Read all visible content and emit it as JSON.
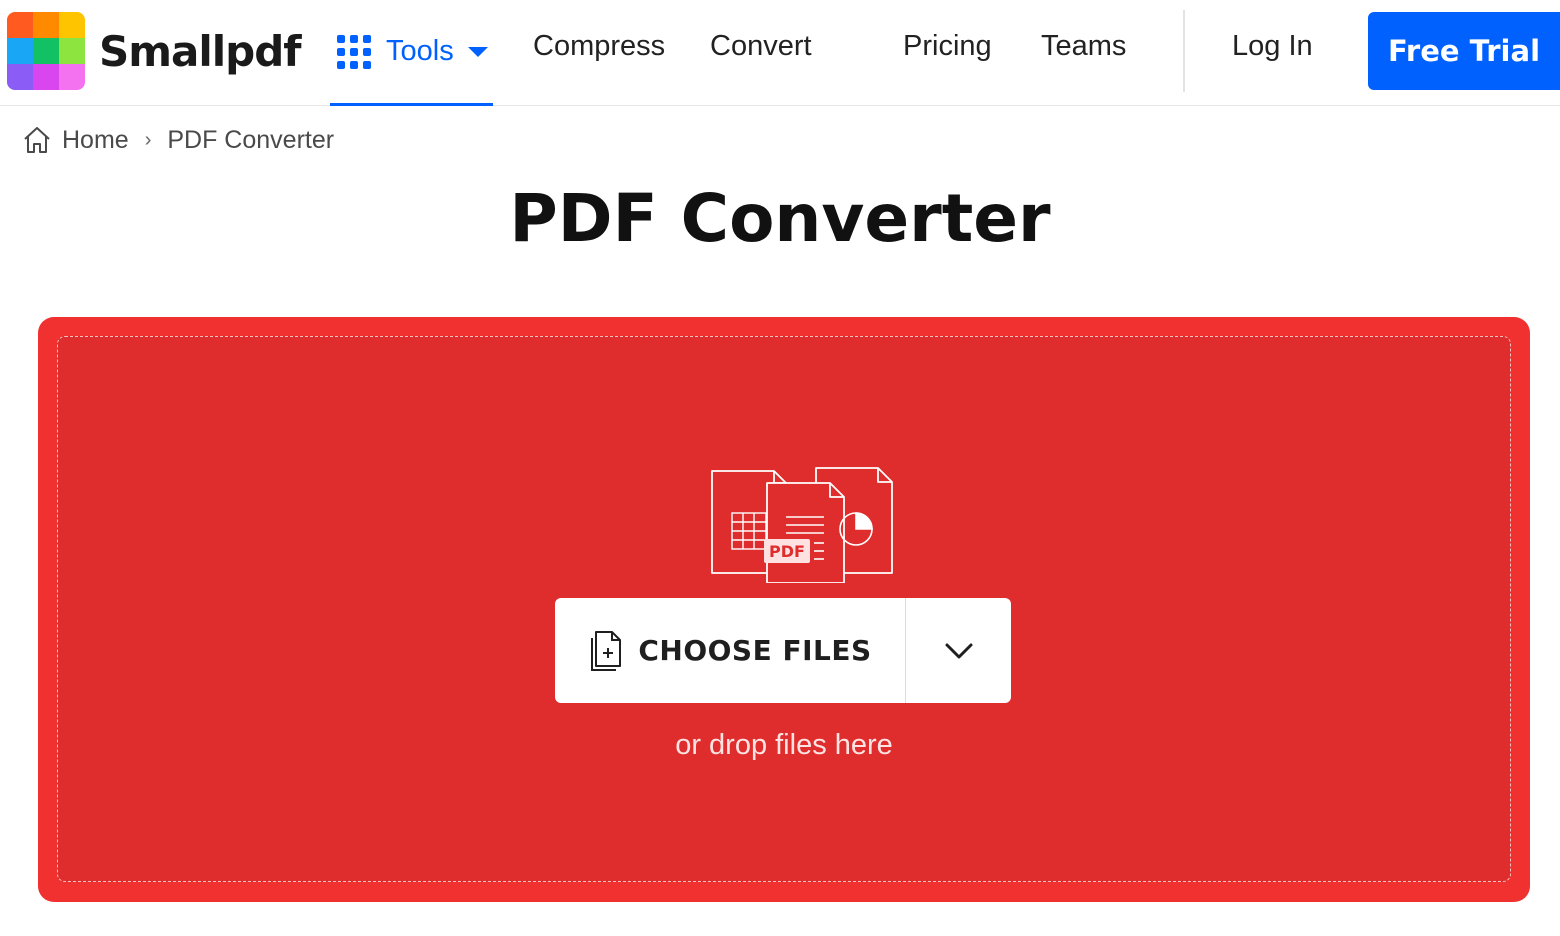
{
  "brand": {
    "name": "Smallpdf",
    "logo_colors": [
      "#ff5a1f",
      "#ff8a00",
      "#ffc400",
      "#19a7f5",
      "#12c163",
      "#8ee43e",
      "#8b5cf6",
      "#d946ef",
      "#f472f0"
    ]
  },
  "nav": {
    "tools_label": "Tools",
    "links": [
      "Compress",
      "Convert",
      "Pricing",
      "Teams"
    ],
    "login_label": "Log In",
    "free_trial_label": "Free Trial"
  },
  "breadcrumb": {
    "home_label": "Home",
    "separator": "›",
    "current_label": "PDF Converter"
  },
  "page": {
    "title": "PDF Converter"
  },
  "dropzone": {
    "badge_text": "PDF",
    "choose_files_label": "CHOOSE FILES",
    "drop_hint": "or drop files here"
  },
  "colors": {
    "accent": "#0061fe",
    "dropzone_outer": "#f0312f",
    "dropzone_inner": "#de2d2c"
  },
  "icons": [
    "tools-grid-icon",
    "caret-down-icon",
    "home-icon",
    "file-add-icon",
    "chevron-down-icon",
    "files-illustration-icon"
  ]
}
